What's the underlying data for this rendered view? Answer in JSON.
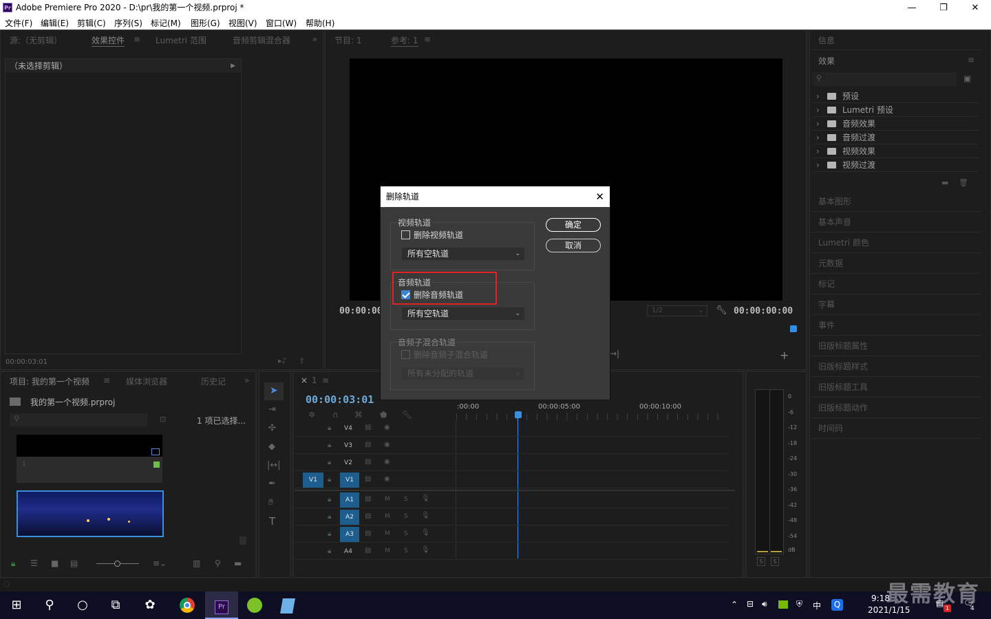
{
  "window": {
    "title": "Adobe Premiere Pro 2020 - D:\\pr\\我的第一个视频.prproj *",
    "app_icon": "Pr"
  },
  "menu": [
    "文件(F)",
    "编辑(E)",
    "剪辑(C)",
    "序列(S)",
    "标记(M)",
    "图形(G)",
    "视图(V)",
    "窗口(W)",
    "帮助(H)"
  ],
  "source_panel": {
    "tabs": [
      "源:（无剪辑）",
      "效果控件",
      "Lumetri 范围",
      "音频剪辑混合器"
    ],
    "no_clip": "（未选择剪辑）",
    "timecode": "00:00:03:01"
  },
  "program_panel": {
    "tabs": [
      "节目: 1",
      "参考: 1"
    ],
    "timecode_left": "00:00:00",
    "timecode_right": "00:00:00:00",
    "zoom": "1/2"
  },
  "project_panel": {
    "tabs": [
      "项目: 我的第一个视频",
      "媒体浏览器",
      "历史记"
    ],
    "file": "我的第一个视频.prproj",
    "selection": "1 项已选择...",
    "item_number": "1"
  },
  "timeline": {
    "tab": "1",
    "timecode": "00:00:03:01",
    "ruler": [
      ":00:00",
      "00:00:05:00",
      "00:00:10:00"
    ],
    "video_tracks": [
      "V4",
      "V3",
      "V2",
      "V1"
    ],
    "audio_tracks": [
      "A1",
      "A2",
      "A3",
      "A4"
    ],
    "source_patch_v": "V1",
    "track_m": "M",
    "track_s": "S"
  },
  "meter": {
    "labels": [
      "0",
      "-6",
      "-12",
      "-18",
      "-24",
      "-30",
      "-36",
      "-42",
      "-48",
      "-54",
      "dB"
    ],
    "solo": "S"
  },
  "right_panel": {
    "info": "信息",
    "effects": "效果",
    "fx_items": [
      "预设",
      "Lumetri 预设",
      "音频效果",
      "音频过渡",
      "视频效果",
      "视频过渡"
    ],
    "panels": [
      "基本图形",
      "基本声音",
      "Lumetri 颜色",
      "元数据",
      "标记",
      "字幕",
      "事件",
      "旧版标题属性",
      "旧版标题样式",
      "旧版标题工具",
      "旧版标题动作",
      "时间码"
    ]
  },
  "dialog": {
    "title": "删除轨道",
    "ok": "确定",
    "cancel": "取消",
    "video_group": "视频轨道",
    "video_check": "删除视频轨道",
    "video_select": "所有空轨道",
    "audio_group": "音频轨道",
    "audio_check": "删除音频轨道",
    "audio_select": "所有空轨道",
    "submix_group": "音频子混合轨道",
    "submix_check": "删除音频子混合轨道",
    "submix_select": "所有未分配的轨道"
  },
  "taskbar": {
    "time": "9:18",
    "date": "2021/1/15",
    "ime": "中",
    "watermark": "最需教育",
    "notif_count": "4",
    "badge": "1",
    "pr": "Pr"
  },
  "colors": {
    "accent": "#3b84d6",
    "highlight_box": "#e02424",
    "track_blue": "#1e5e8e"
  }
}
